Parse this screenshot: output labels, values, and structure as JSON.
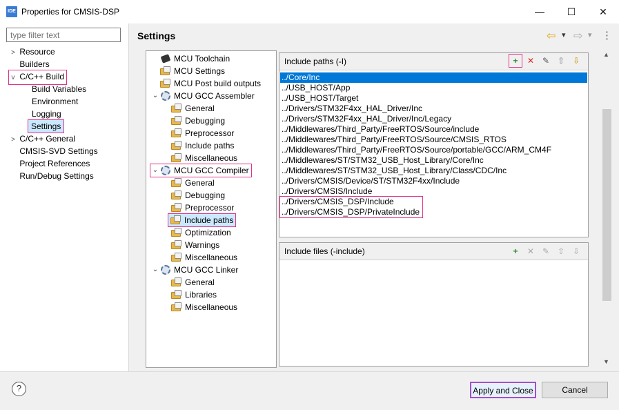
{
  "window": {
    "title": "Properties for CMSIS-DSP",
    "app_icon_text": "IDE",
    "minimize_glyph": "—",
    "maximize_glyph": "☐",
    "close_glyph": "✕"
  },
  "filter": {
    "placeholder": "type filter text"
  },
  "nav": {
    "items": [
      {
        "label": "Resource",
        "chevron": ">"
      },
      {
        "label": "Builders",
        "chevron": ""
      },
      {
        "label": "C/C++ Build",
        "chevron": "v"
      },
      {
        "label": "Build Variables",
        "chevron": ""
      },
      {
        "label": "Environment",
        "chevron": ""
      },
      {
        "label": "Logging",
        "chevron": ""
      },
      {
        "label": "Settings",
        "chevron": ""
      },
      {
        "label": "C/C++ General",
        "chevron": ">"
      },
      {
        "label": "CMSIS-SVD Settings",
        "chevron": ""
      },
      {
        "label": "Project References",
        "chevron": ""
      },
      {
        "label": "Run/Debug Settings",
        "chevron": ""
      }
    ]
  },
  "settings": {
    "title": "Settings",
    "nav_back": "⇦",
    "nav_forward": "⇨",
    "menu_glyph": "⋮",
    "dropdown_glyph": "▾"
  },
  "tool_tree": {
    "items": [
      {
        "label": "MCU Toolchain"
      },
      {
        "label": "MCU Settings"
      },
      {
        "label": "MCU Post build outputs"
      },
      {
        "label": "MCU GCC Assembler"
      },
      {
        "label": "General"
      },
      {
        "label": "Debugging"
      },
      {
        "label": "Preprocessor"
      },
      {
        "label": "Include paths"
      },
      {
        "label": "Miscellaneous"
      },
      {
        "label": "MCU GCC Compiler"
      },
      {
        "label": "General"
      },
      {
        "label": "Debugging"
      },
      {
        "label": "Preprocessor"
      },
      {
        "label": "Include paths"
      },
      {
        "label": "Optimization"
      },
      {
        "label": "Warnings"
      },
      {
        "label": "Miscellaneous"
      },
      {
        "label": "MCU GCC Linker"
      },
      {
        "label": "General"
      },
      {
        "label": "Libraries"
      },
      {
        "label": "Miscellaneous"
      }
    ]
  },
  "include_paths": {
    "label": "Include paths (-I)",
    "paths": [
      "../Core/Inc",
      "../USB_HOST/App",
      "../USB_HOST/Target",
      "../Drivers/STM32F4xx_HAL_Driver/Inc",
      "../Drivers/STM32F4xx_HAL_Driver/Inc/Legacy",
      "../Middlewares/Third_Party/FreeRTOS/Source/include",
      "../Middlewares/Third_Party/FreeRTOS/Source/CMSIS_RTOS",
      "../Middlewares/Third_Party/FreeRTOS/Source/portable/GCC/ARM_CM4F",
      "../Middlewares/ST/STM32_USB_Host_Library/Core/Inc",
      "../Middlewares/ST/STM32_USB_Host_Library/Class/CDC/Inc",
      "../Drivers/CMSIS/Device/ST/STM32F4xx/Include",
      "../Drivers/CMSIS/Include",
      "../Drivers/CMSIS_DSP/Include",
      "../Drivers/CMSIS_DSP/PrivateInclude"
    ]
  },
  "include_files": {
    "label": "Include files (-include)"
  },
  "toolbar": {
    "add_glyph": "+",
    "delete_glyph": "✕",
    "edit_glyph": "✎",
    "up_glyph": "⇧",
    "down_glyph": "⇩"
  },
  "buttons": {
    "help": "?",
    "apply_close": "Apply and Close",
    "cancel": "Cancel"
  },
  "colors": {
    "highlight": "#e0338b",
    "selection": "#0078d7"
  }
}
